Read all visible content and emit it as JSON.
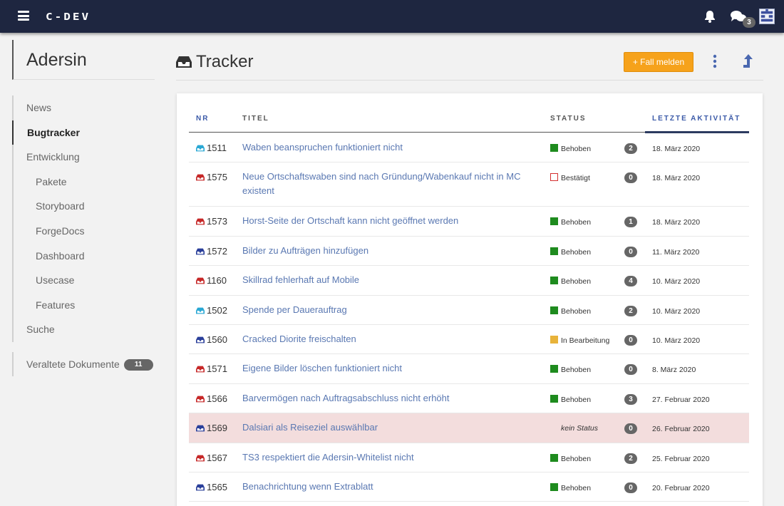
{
  "app": {
    "logo": "C-DEV"
  },
  "topbar": {
    "chat_count": "3"
  },
  "sidebar": {
    "title": "Adersin",
    "items": [
      {
        "label": "News",
        "sub": false,
        "active": false
      },
      {
        "label": "Bugtracker",
        "sub": false,
        "active": true
      },
      {
        "label": "Entwicklung",
        "sub": false,
        "active": false
      },
      {
        "label": "Pakete",
        "sub": true,
        "active": false
      },
      {
        "label": "Storyboard",
        "sub": true,
        "active": false
      },
      {
        "label": "ForgeDocs",
        "sub": true,
        "active": false
      },
      {
        "label": "Dashboard",
        "sub": true,
        "active": false
      },
      {
        "label": "Usecase",
        "sub": true,
        "active": false
      },
      {
        "label": "Features",
        "sub": true,
        "active": false
      },
      {
        "label": "Suche",
        "sub": false,
        "active": false
      }
    ],
    "outdated": {
      "label": "Veraltete Dokumente",
      "count": "11"
    }
  },
  "header": {
    "title": "Tracker",
    "report_button": "+ Fall melden"
  },
  "table": {
    "columns": {
      "nr": "NR",
      "title": "TITEL",
      "status": "STATUS",
      "activity": "LETZTE AKTIVITÄT"
    },
    "rows": [
      {
        "nr": "1511",
        "icon_color": "#2aa8d4",
        "title": "Waben beanspruchen funktioniert nicht",
        "status": "Behoben",
        "status_color": "#1e8b1e",
        "status_outline": false,
        "count": "2",
        "date": "18. März 2020"
      },
      {
        "nr": "1575",
        "icon_color": "#c62828",
        "title": "Neue Ortschaftswaben sind nach Gründung/Wabenkauf nicht in MC existent",
        "status": "Bestätigt",
        "status_color": "#d32f2f",
        "status_outline": true,
        "count": "0",
        "date": "18. März 2020"
      },
      {
        "nr": "1573",
        "icon_color": "#c62828",
        "title": "Horst-Seite der Ortschaft kann nicht geöffnet werden",
        "status": "Behoben",
        "status_color": "#1e8b1e",
        "status_outline": false,
        "count": "1",
        "date": "18. März 2020"
      },
      {
        "nr": "1572",
        "icon_color": "#2a3f9a",
        "title": "Bilder zu Aufträgen hinzufügen",
        "status": "Behoben",
        "status_color": "#1e8b1e",
        "status_outline": false,
        "count": "0",
        "date": "11. März 2020"
      },
      {
        "nr": "1160",
        "icon_color": "#c62828",
        "title": "Skillrad fehlerhaft auf Mobile",
        "status": "Behoben",
        "status_color": "#1e8b1e",
        "status_outline": false,
        "count": "4",
        "date": "10. März 2020"
      },
      {
        "nr": "1502",
        "icon_color": "#2aa8d4",
        "title": "Spende per Dauerauftrag",
        "status": "Behoben",
        "status_color": "#1e8b1e",
        "status_outline": false,
        "count": "2",
        "date": "10. März 2020"
      },
      {
        "nr": "1560",
        "icon_color": "#2a3f9a",
        "title": "Cracked Diorite freischalten",
        "status": "In Bearbeitung",
        "status_color": "#e8b33a",
        "status_outline": false,
        "count": "0",
        "date": "10. März 2020"
      },
      {
        "nr": "1571",
        "icon_color": "#c62828",
        "title": "Eigene Bilder löschen funktioniert nicht",
        "status": "Behoben",
        "status_color": "#1e8b1e",
        "status_outline": false,
        "count": "0",
        "date": "8. März 2020"
      },
      {
        "nr": "1566",
        "icon_color": "#c62828",
        "title": "Barvermögen nach Auftragsabschluss nicht erhöht",
        "status": "Behoben",
        "status_color": "#1e8b1e",
        "status_outline": false,
        "count": "3",
        "date": "27. Februar 2020"
      },
      {
        "nr": "1569",
        "icon_color": "#2a3f9a",
        "title": "Dalsiari als Reiseziel auswählbar",
        "status": "kein Status",
        "status_color": "",
        "status_outline": false,
        "count": "0",
        "date": "26. Februar 2020",
        "highlight": true
      },
      {
        "nr": "1567",
        "icon_color": "#c62828",
        "title": "TS3 respektiert die Adersin-Whitelist nicht",
        "status": "Behoben",
        "status_color": "#1e8b1e",
        "status_outline": false,
        "count": "2",
        "date": "25. Februar 2020"
      },
      {
        "nr": "1565",
        "icon_color": "#2a3f9a",
        "title": "Benachrichtung wenn Extrablatt",
        "status": "Behoben",
        "status_color": "#1e8b1e",
        "status_outline": false,
        "count": "0",
        "date": "20. Februar 2020"
      }
    ]
  }
}
